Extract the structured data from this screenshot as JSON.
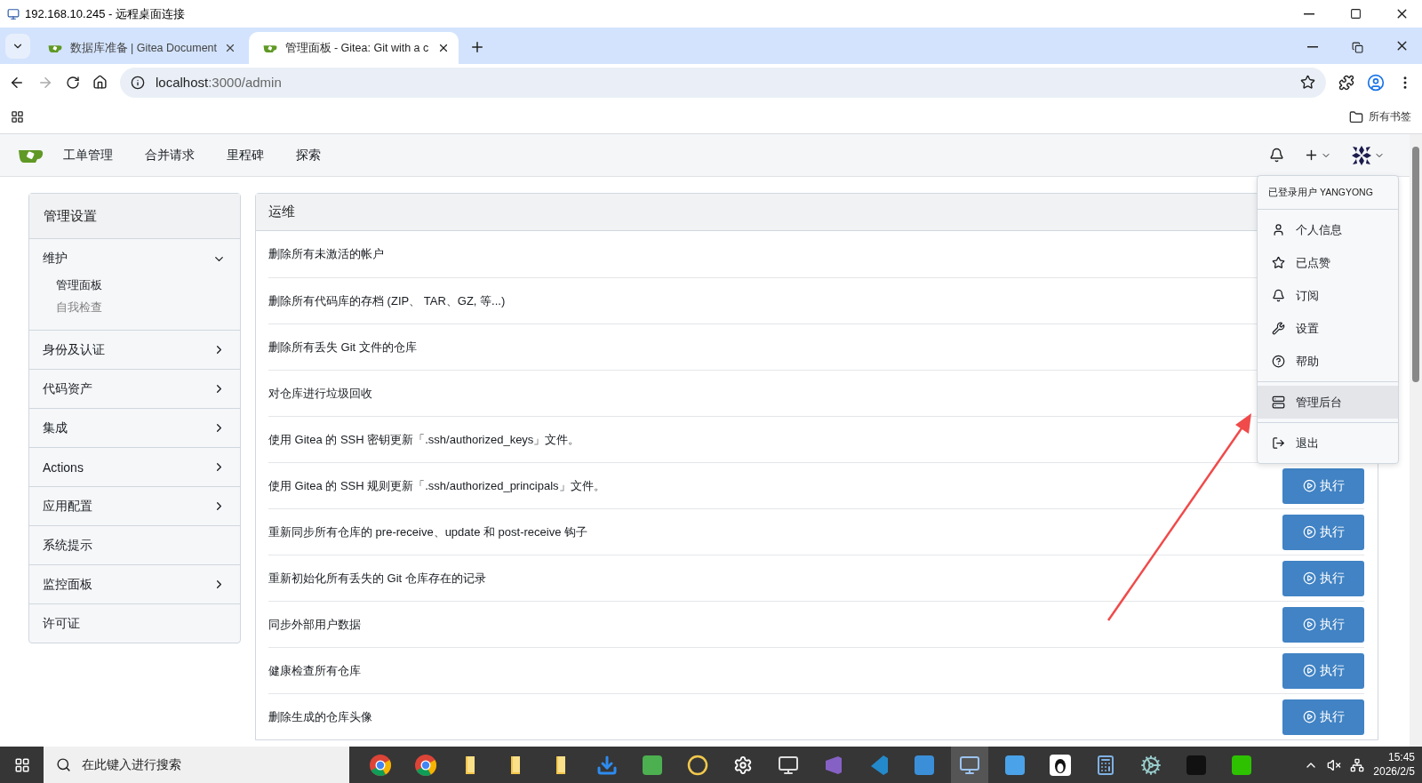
{
  "remote_window": {
    "title": "192.168.10.245 - 远程桌面连接"
  },
  "browser": {
    "tabs": [
      {
        "title": "数据库准备 | Gitea Document",
        "selected": false
      },
      {
        "title": "管理面板 - Gitea: Git with a c",
        "selected": true
      }
    ],
    "url_host": "localhost",
    "url_path": ":3000/admin",
    "bookmarks_folder": "所有书签"
  },
  "navbar": {
    "items": [
      "工单管理",
      "合并请求",
      "里程碑",
      "探索"
    ]
  },
  "sidebar": {
    "title": "管理设置",
    "items": [
      {
        "kind": "group",
        "label": "维护",
        "expanded": true,
        "children": [
          {
            "label": "管理面板",
            "selected": true
          },
          {
            "label": "自我检查",
            "selected": false
          }
        ]
      },
      {
        "kind": "group",
        "label": "身份及认证",
        "expanded": false
      },
      {
        "kind": "group",
        "label": "代码资产",
        "expanded": false
      },
      {
        "kind": "group",
        "label": "集成",
        "expanded": false
      },
      {
        "kind": "group",
        "label": "Actions",
        "expanded": false
      },
      {
        "kind": "group",
        "label": "应用配置",
        "expanded": false
      },
      {
        "kind": "link",
        "label": "系统提示"
      },
      {
        "kind": "group",
        "label": "监控面板",
        "expanded": false
      },
      {
        "kind": "link",
        "label": "许可证"
      }
    ]
  },
  "panel": {
    "title": "运维",
    "rows": [
      {
        "label": "删除所有未激活的帐户"
      },
      {
        "label": "删除所有代码库的存档 (ZIP、 TAR、GZ, 等...)"
      },
      {
        "label": "删除所有丢失 Git 文件的仓库"
      },
      {
        "label": "对仓库进行垃圾回收"
      },
      {
        "label": "使用 Gitea 的 SSH 密钥更新「.ssh/authorized_keys」文件。"
      },
      {
        "label": "使用 Gitea 的 SSH 规则更新「.ssh/authorized_principals」文件。",
        "button": "执行"
      },
      {
        "label": "重新同步所有仓库的 pre-receive、update 和 post-receive 钩子",
        "button": "执行"
      },
      {
        "label": "重新初始化所有丢失的 Git 仓库存在的记录",
        "button": "执行"
      },
      {
        "label": "同步外部用户数据",
        "button": "执行"
      },
      {
        "label": "健康检查所有仓库",
        "button": "执行"
      },
      {
        "label": "删除生成的仓库头像",
        "button": "执行"
      }
    ]
  },
  "user_menu": {
    "header": "已登录用户 YANGYONG",
    "sections": [
      {
        "items": [
          {
            "kind": "profile",
            "label": "个人信息",
            "selected": false
          },
          {
            "kind": "star",
            "label": "已点赞",
            "selected": false
          },
          {
            "kind": "bell",
            "label": "订阅",
            "selected": false
          },
          {
            "kind": "wrench",
            "label": "设置",
            "selected": false
          },
          {
            "kind": "help",
            "label": "帮助",
            "selected": false
          }
        ]
      },
      {
        "items": [
          {
            "kind": "admin",
            "label": "管理后台",
            "selected": true
          }
        ]
      },
      {
        "items": [
          {
            "kind": "logout",
            "label": "退出",
            "selected": false
          }
        ]
      }
    ]
  },
  "taskbar": {
    "search_placeholder": "在此键入进行搜索",
    "time": "15:45",
    "date": "2026/2/5"
  }
}
